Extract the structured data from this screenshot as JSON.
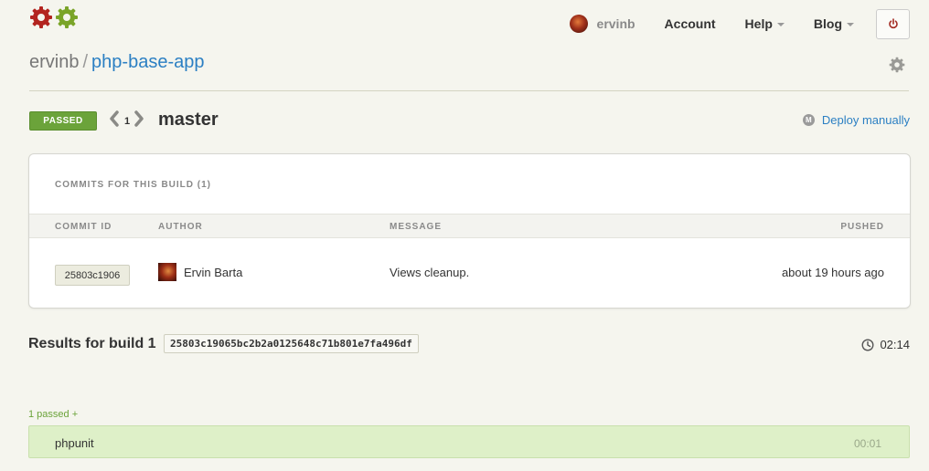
{
  "colors": {
    "accent_link": "#2b7fc3",
    "passed_green": "#6ba33a",
    "test_row_bg": "#def0c8",
    "page_bg": "#f5f5ee"
  },
  "header": {
    "logo_icons": [
      "red-gear-icon",
      "green-gear-icon"
    ],
    "user_name": "ervinb",
    "nav": {
      "account": "Account",
      "help": "Help",
      "blog": "Blog"
    },
    "power_icon": "power-icon"
  },
  "breadcrumb": {
    "owner": "ervinb",
    "separator": "/",
    "repo": "php-base-app"
  },
  "build": {
    "status": "PASSED",
    "number": "1",
    "branch": "master",
    "deploy_label": "Deploy manually",
    "deploy_icon_letter": "M"
  },
  "commits": {
    "title": "COMMITS FOR THIS BUILD (1)",
    "columns": {
      "commit_id": "COMMIT ID",
      "author": "AUTHOR",
      "message": "MESSAGE",
      "pushed": "PUSHED"
    },
    "rows": [
      {
        "commit_id": "25803c1906",
        "author": "Ervin Barta",
        "message": "Views cleanup.",
        "pushed": "about 19 hours ago"
      }
    ]
  },
  "results": {
    "label": "Results for build 1",
    "sha": "25803c19065bc2b2a0125648c71b801e7fa496df",
    "duration": "02:14"
  },
  "tests": {
    "summary": "1 passed +",
    "items": [
      {
        "name": "phpunit",
        "time": "00:01"
      }
    ]
  }
}
